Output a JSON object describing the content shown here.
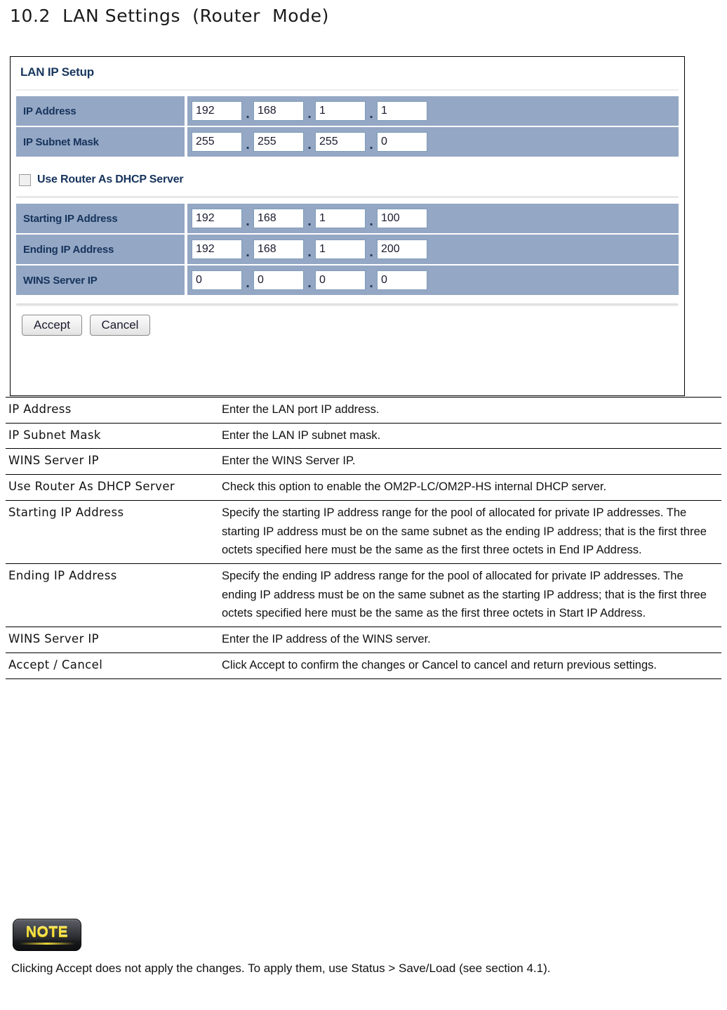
{
  "heading": "10.2  LAN Settings  (Router  Mode)",
  "panel": {
    "title": "LAN IP Setup",
    "rows": [
      {
        "label": "IP Address",
        "octets": [
          "192",
          "168",
          "1",
          "1"
        ]
      },
      {
        "label": "IP Subnet Mask",
        "octets": [
          "255",
          "255",
          "255",
          "0"
        ]
      }
    ],
    "checkbox": {
      "label": "Use Router As DHCP Server",
      "checked": false
    },
    "dhcp_rows": [
      {
        "label": "Starting IP Address",
        "octets": [
          "192",
          "168",
          "1",
          "100"
        ]
      },
      {
        "label": "Ending IP Address",
        "octets": [
          "192",
          "168",
          "1",
          "200"
        ]
      },
      {
        "label": "WINS Server IP",
        "octets": [
          "0",
          "0",
          "0",
          "0"
        ]
      }
    ],
    "separator": ".",
    "buttons": {
      "accept": "Accept",
      "cancel": "Cancel"
    }
  },
  "description_table": {
    "rows": [
      {
        "term": "IP Address",
        "definition": "Enter the LAN port IP address."
      },
      {
        "term": "IP Subnet Mask",
        "definition": "Enter the LAN IP subnet mask."
      },
      {
        "term": "WINS Server IP",
        "definition": "Enter the WINS Server IP."
      },
      {
        "term": "Use Router  As DHCP Server",
        "definition": "Check this option to enable the OM2P-LC/OM2P-HS internal DHCP server."
      },
      {
        "term": "Starting  IP Address",
        "definition": "Specify the starting IP address range for the pool of allocated for private IP addresses. The starting IP address must be on the same subnet as the ending IP address; that is the first three octets specified here must be the same as the first three octets in End IP Address."
      },
      {
        "term": "Ending  IP Address",
        "definition": "Specify the ending IP address range for the pool of allocated for private IP addresses. The ending IP address must be on the same subnet as the starting IP address; that is the first three octets specified here must be the same as the first three octets in Start IP Address."
      },
      {
        "term": "WINS  Server  IP",
        "definition": "Enter the IP address of the WINS server."
      },
      {
        "term": "Accept  / Cancel",
        "definition": "Click Accept  to confirm the changes or Cancel  to cancel and return previous settings."
      }
    ]
  },
  "note": {
    "badge_label": "NOTE",
    "text": "Clicking Accept  does not apply the changes. To apply them, use Status  >  Save/Load  (see section 4.1)."
  },
  "colors": {
    "row_band": "#94a7c4",
    "label_text": "#16335c",
    "panel_title": "#17365d",
    "note_yellow": "#f5e03c"
  }
}
